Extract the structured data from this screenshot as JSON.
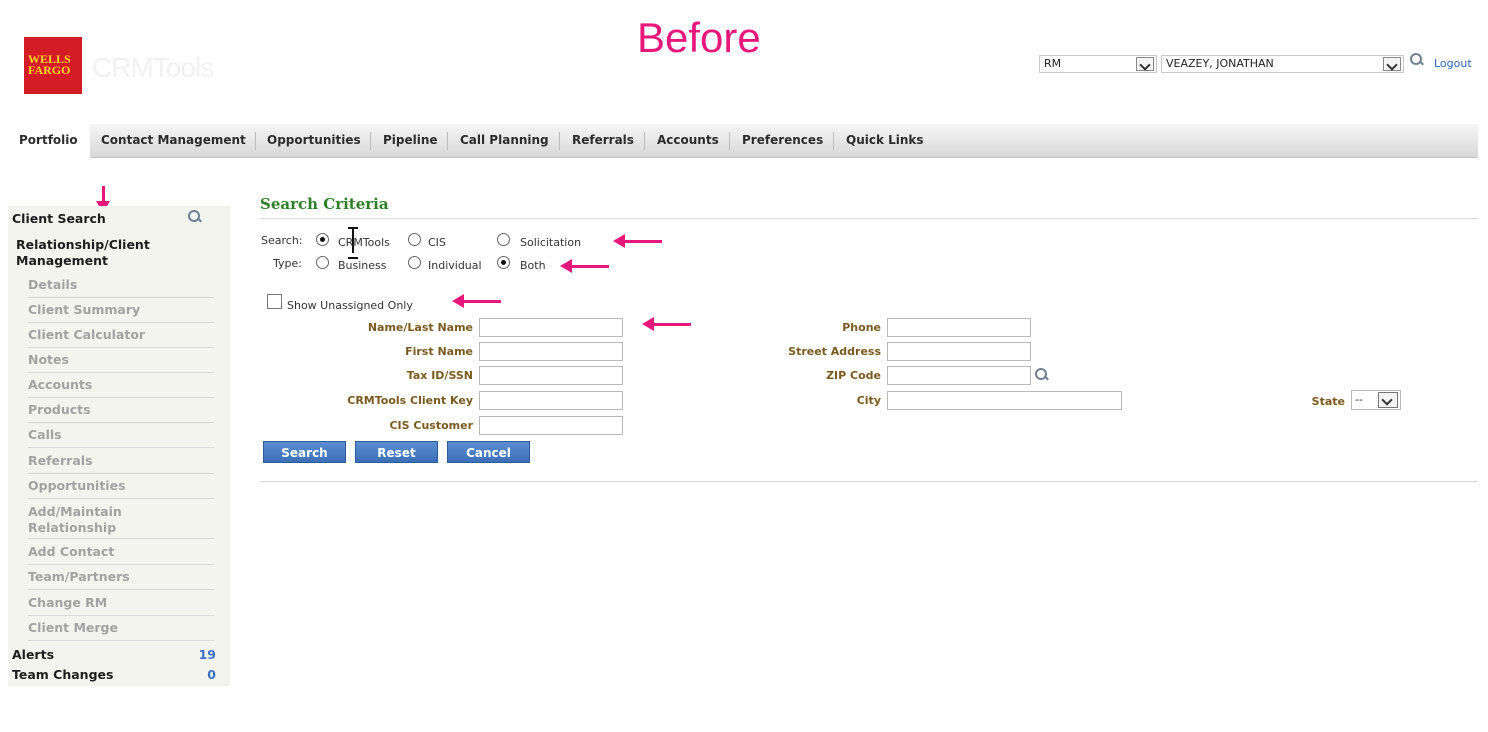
{
  "annotation": {
    "title": "Before"
  },
  "header": {
    "logo_line1": "WELLS",
    "logo_line2": "FARGO",
    "brand": "CRMTools",
    "role_select": "RM",
    "user_select": "VEAZEY, JONATHAN",
    "logout": "Logout"
  },
  "nav": {
    "tabs": [
      {
        "label": "Portfolio"
      },
      {
        "label": "Contact Management"
      },
      {
        "label": "Opportunities"
      },
      {
        "label": "Pipeline"
      },
      {
        "label": "Call Planning"
      },
      {
        "label": "Referrals"
      },
      {
        "label": "Accounts"
      },
      {
        "label": "Preferences"
      },
      {
        "label": "Quick Links"
      }
    ]
  },
  "sidebar": {
    "client_search": "Client Search",
    "relationship": "Relationship/Client Management",
    "items": [
      {
        "label": "Details"
      },
      {
        "label": "Client Summary"
      },
      {
        "label": "Client Calculator"
      },
      {
        "label": "Notes"
      },
      {
        "label": "Accounts"
      },
      {
        "label": "Products"
      },
      {
        "label": "Calls"
      },
      {
        "label": "Referrals"
      },
      {
        "label": "Opportunities"
      },
      {
        "label": "Add/Maintain Relationship"
      },
      {
        "label": "Add Contact"
      },
      {
        "label": "Team/Partners"
      },
      {
        "label": "Change RM"
      },
      {
        "label": "Client Merge"
      }
    ],
    "alerts": {
      "label": "Alerts",
      "count": "19"
    },
    "team_changes": {
      "label": "Team Changes",
      "count": "0"
    }
  },
  "main": {
    "title": "Search Criteria",
    "search_label": "Search:",
    "search_options": [
      {
        "label": "CRMTools",
        "selected": true
      },
      {
        "label": "CIS",
        "selected": false
      },
      {
        "label": "Solicitation",
        "selected": false
      }
    ],
    "type_label": "Type:",
    "type_options": [
      {
        "label": "Business",
        "selected": false
      },
      {
        "label": "Individual",
        "selected": false
      },
      {
        "label": "Both",
        "selected": true
      }
    ],
    "show_unassigned": "Show Unassigned Only",
    "fields": {
      "name_last": "Name/Last Name",
      "first_name": "First Name",
      "tax_id": "Tax ID/SSN",
      "client_key": "CRMTools Client Key",
      "cis_customer": "CIS Customer",
      "phone": "Phone",
      "street": "Street Address",
      "zip": "ZIP Code",
      "city": "City",
      "state": "State",
      "state_value": "--"
    },
    "buttons": {
      "search": "Search",
      "reset": "Reset",
      "cancel": "Cancel"
    }
  },
  "colors": {
    "annotation": "#e8177c",
    "title_green": "#2f7f2a",
    "button_blue": "#3c6fb7",
    "logo_red": "#d41c24"
  }
}
